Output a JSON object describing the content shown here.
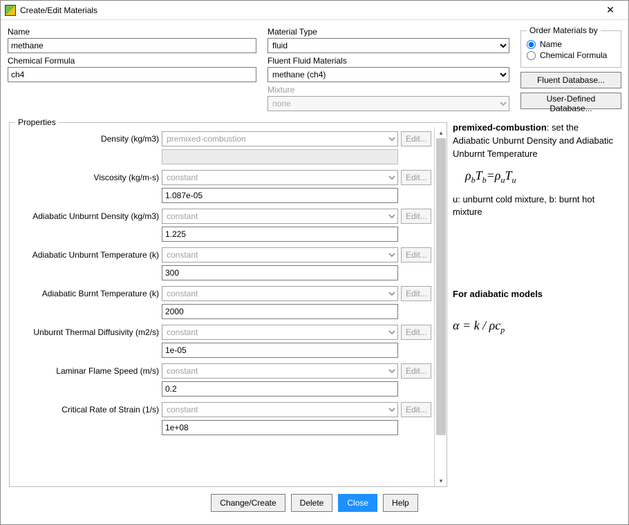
{
  "window": {
    "title": "Create/Edit Materials"
  },
  "labels": {
    "name": "Name",
    "chemical_formula": "Chemical Formula",
    "material_type": "Material Type",
    "fluent_fluid": "Fluent Fluid Materials",
    "mixture": "Mixture",
    "order_legend": "Order Materials by",
    "order_name": "Name",
    "order_chem": "Chemical Formula",
    "properties": "Properties",
    "edit_btn": "Edit..."
  },
  "fields": {
    "name": "methane",
    "chemical_formula": "ch4",
    "material_type": "fluid",
    "fluent_fluid": "methane (ch4)",
    "mixture": "none"
  },
  "order": {
    "selected": "name"
  },
  "side_buttons": {
    "fluent_db": "Fluent Database...",
    "user_db": "User-Defined Database..."
  },
  "properties": [
    {
      "label": "Density (kg/m3)",
      "method": "premixed-combustion",
      "value_blank": true
    },
    {
      "label": "Viscosity (kg/m-s)",
      "method": "constant",
      "value": "1.087e-05"
    },
    {
      "label": "Adiabatic Unburnt Density (kg/m3)",
      "method": "constant",
      "value": "1.225"
    },
    {
      "label": "Adiabatic Unburnt Temperature (k)",
      "method": "constant",
      "value": "300"
    },
    {
      "label": "Adiabatic Burnt Temperature (k)",
      "method": "constant",
      "value": "2000"
    },
    {
      "label": "Unburnt Thermal Diffusivity (m2/s)",
      "method": "constant",
      "value": "1e-05"
    },
    {
      "label": "Laminar Flame Speed (m/s)",
      "method": "constant",
      "value": "0.2"
    },
    {
      "label": "Critical Rate of Strain (1/s)",
      "method": "constant",
      "value": "1e+08"
    }
  ],
  "notes": {
    "pc_bold": "premixed-combustion",
    "pc_rest": ": set the Adiabatic Unburnt Density and Adiabatic Unburnt Temperature",
    "u_b_desc": "u: unburnt cold mixture, b: burnt hot mixture",
    "adiab_hdr": "For adiabatic models"
  },
  "footer": {
    "change_create": "Change/Create",
    "delete": "Delete",
    "close": "Close",
    "help": "Help"
  }
}
